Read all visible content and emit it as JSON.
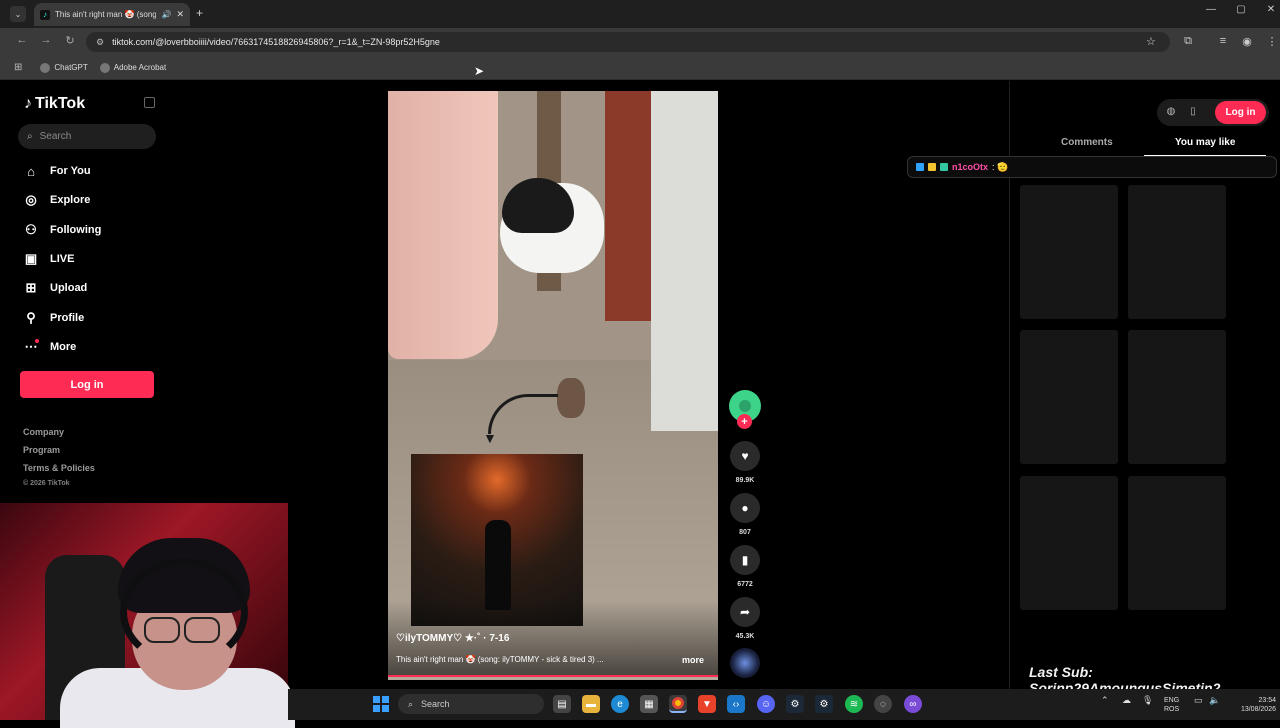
{
  "browser": {
    "tab_title": "This ain't right man 🤡 (song",
    "url": "tiktok.com/@loverbboiiii/video/7663174518826945806?_r=1&_t=ZN-98pr52H5gne",
    "bookmarks": [
      "ChatGPT",
      "Adobe Acrobat"
    ]
  },
  "sidebar": {
    "logo": "TikTok",
    "search_placeholder": "Search",
    "nav": [
      {
        "label": "For You",
        "icon": "home-icon"
      },
      {
        "label": "Explore",
        "icon": "compass-icon"
      },
      {
        "label": "Following",
        "icon": "following-icon"
      },
      {
        "label": "LIVE",
        "icon": "live-icon"
      },
      {
        "label": "Upload",
        "icon": "upload-icon"
      },
      {
        "label": "Profile",
        "icon": "profile-icon"
      },
      {
        "label": "More",
        "icon": "more-icon"
      }
    ],
    "login_label": "Log in",
    "footer": [
      "Company",
      "Program",
      "Terms & Policies"
    ],
    "copyright": "© 2026 TikTok"
  },
  "video": {
    "author": "♡ilyTOMMY♡ ★·˚ · 7-16",
    "description": "This ain't right man 🤡 (song: ilyTOMMY - sick & tired 3) ...",
    "more_label": "more"
  },
  "actions": {
    "likes": "89.9K",
    "comments": "807",
    "saves": "6772",
    "shares": "45.3K"
  },
  "right_panel": {
    "tabs": [
      "Comments",
      "You may like"
    ],
    "login_label": "Log in"
  },
  "chat": {
    "user": "n1coOtx",
    "message": ": 🫡"
  },
  "stream": {
    "last_sub": "Last Sub: Sorinp29AmoungusSimetin2"
  },
  "taskbar": {
    "search_placeholder": "Search",
    "lang_top": "ENG",
    "lang_bottom": "ROS",
    "time": "23:54",
    "date": "13/08/2026"
  }
}
